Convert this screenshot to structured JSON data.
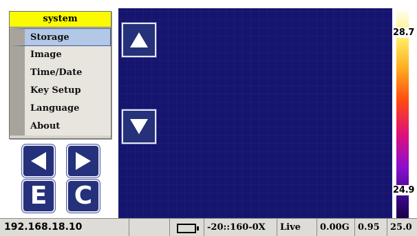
{
  "menu": {
    "title": "system",
    "items": [
      "Storage",
      "Image",
      "Time/Date",
      "Key Setup",
      "Language",
      "About"
    ],
    "selected": "Storage"
  },
  "palette": {
    "max_label": "28.7",
    "min_label": "24.9"
  },
  "buttons": {
    "e_label": "E",
    "c_label": "C"
  },
  "status_bar": {
    "ip": "192.168.18.10",
    "mode": "-20::160-0X",
    "live": "Live",
    "gain": "0.00G",
    "emissivity": "0.95",
    "temperature": "25.0"
  },
  "colors": {
    "thermal_bg": "#15146e",
    "menu_title_bg": "#fafa00",
    "button_bg": "#25317a",
    "selected_bg": "#b3c7e6"
  },
  "icons": [
    "up-arrow-icon",
    "down-arrow-icon",
    "left-arrow-icon",
    "right-arrow-icon",
    "battery-icon"
  ]
}
